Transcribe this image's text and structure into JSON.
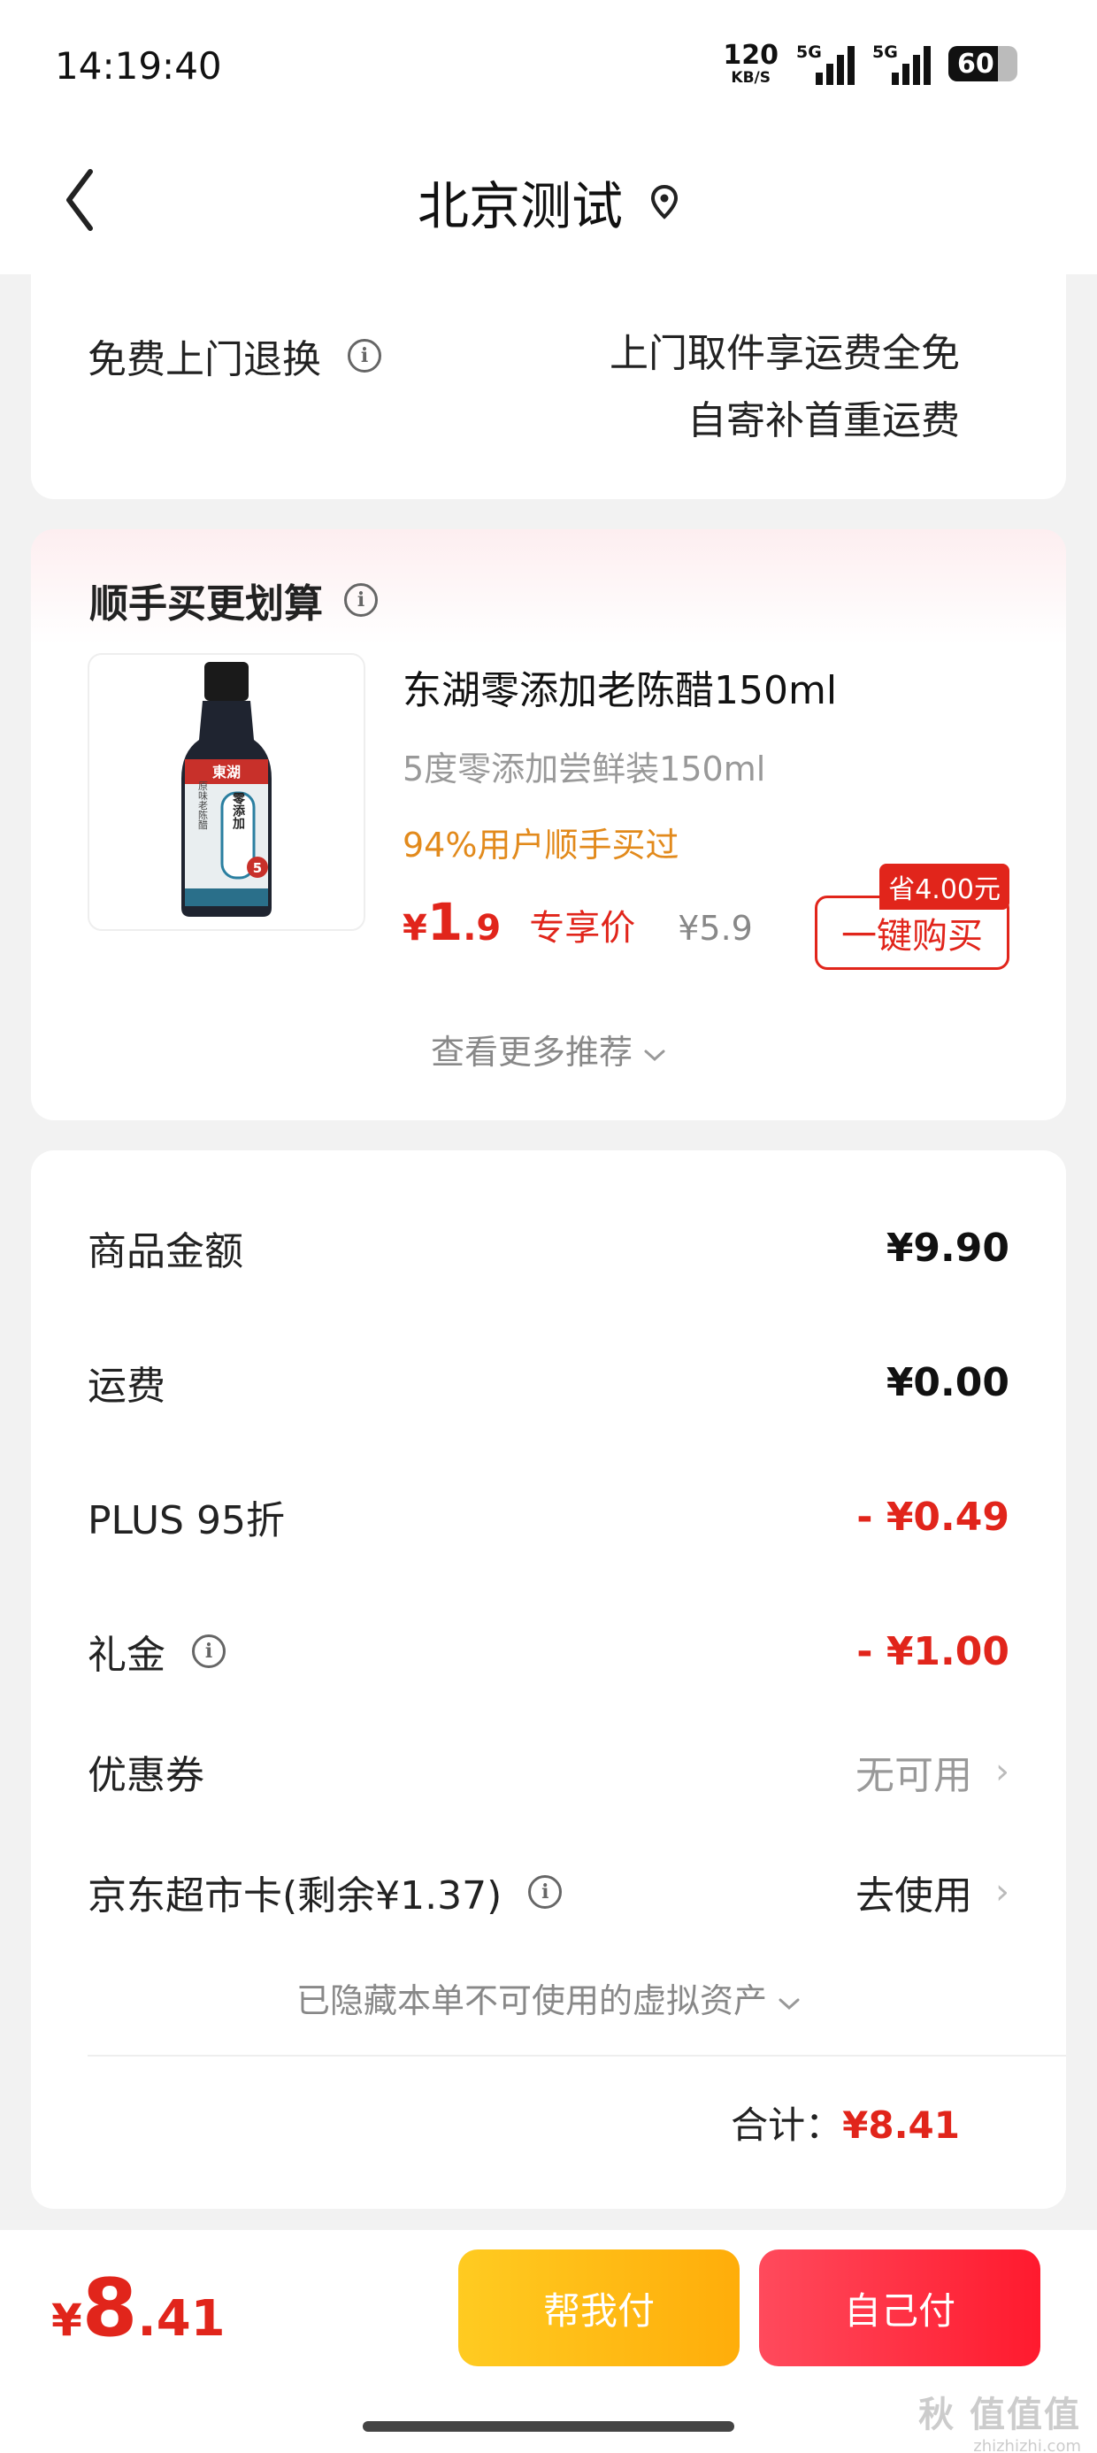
{
  "status_bar": {
    "time": "14:19:40",
    "net_speed_value": "120",
    "net_speed_unit": "KB/S",
    "sim1": "5G",
    "sim2": "5G",
    "battery": "60"
  },
  "header": {
    "title": "北京测试",
    "back_icon": "chevron-left-icon",
    "location_icon": "location-pin-icon"
  },
  "return_service": {
    "label": "免费上门退换",
    "line1": "上门取件享运费全免",
    "line2": "自寄补首重运费"
  },
  "recommend": {
    "title": "顺手买更划算",
    "product": {
      "name": "东湖零添加老陈醋150ml",
      "spec": "5度零添加尝鲜装150ml",
      "rate": "94%用户顺手买过",
      "price_currency": "¥",
      "price_int": "1",
      "price_dec": ".9",
      "price_label": "专享价",
      "original_price": "¥5.9",
      "save_badge": "省4.00元",
      "buy_button": "一键购买",
      "bottle_brand": "東湖",
      "bottle_label": "零添加",
      "bottle_side": "原味老陈醋",
      "bottle_degree": "5"
    },
    "more": "查看更多推荐"
  },
  "order_summary": {
    "rows": [
      {
        "label": "商品金额",
        "value": "¥9.90"
      },
      {
        "label": "运费",
        "value": "¥0.00"
      },
      {
        "label": "PLUS 95折",
        "value": "- ¥0.49"
      },
      {
        "label": "礼金",
        "value": "- ¥1.00"
      },
      {
        "label": "优惠券",
        "value": "无可用"
      },
      {
        "label": "京东超市卡(剩余¥1.37)",
        "value": "去使用"
      }
    ],
    "hidden_note": "已隐藏本单不可使用的虚拟资产",
    "total_label": "合计：",
    "total_value": "¥8.41"
  },
  "bottom_bar": {
    "price_currency": "¥",
    "price_int": "8",
    "price_dec": ".41",
    "help_pay": "帮我付",
    "self_pay": "自己付"
  },
  "watermark": {
    "line1": "秋 值值值",
    "line2": "zhizhizhi.com"
  },
  "colors": {
    "accent_red": "#e1251b",
    "orange": "#e28a1c",
    "help_btn": "#ffbb14",
    "pay_btn": "#ff2a3d"
  }
}
